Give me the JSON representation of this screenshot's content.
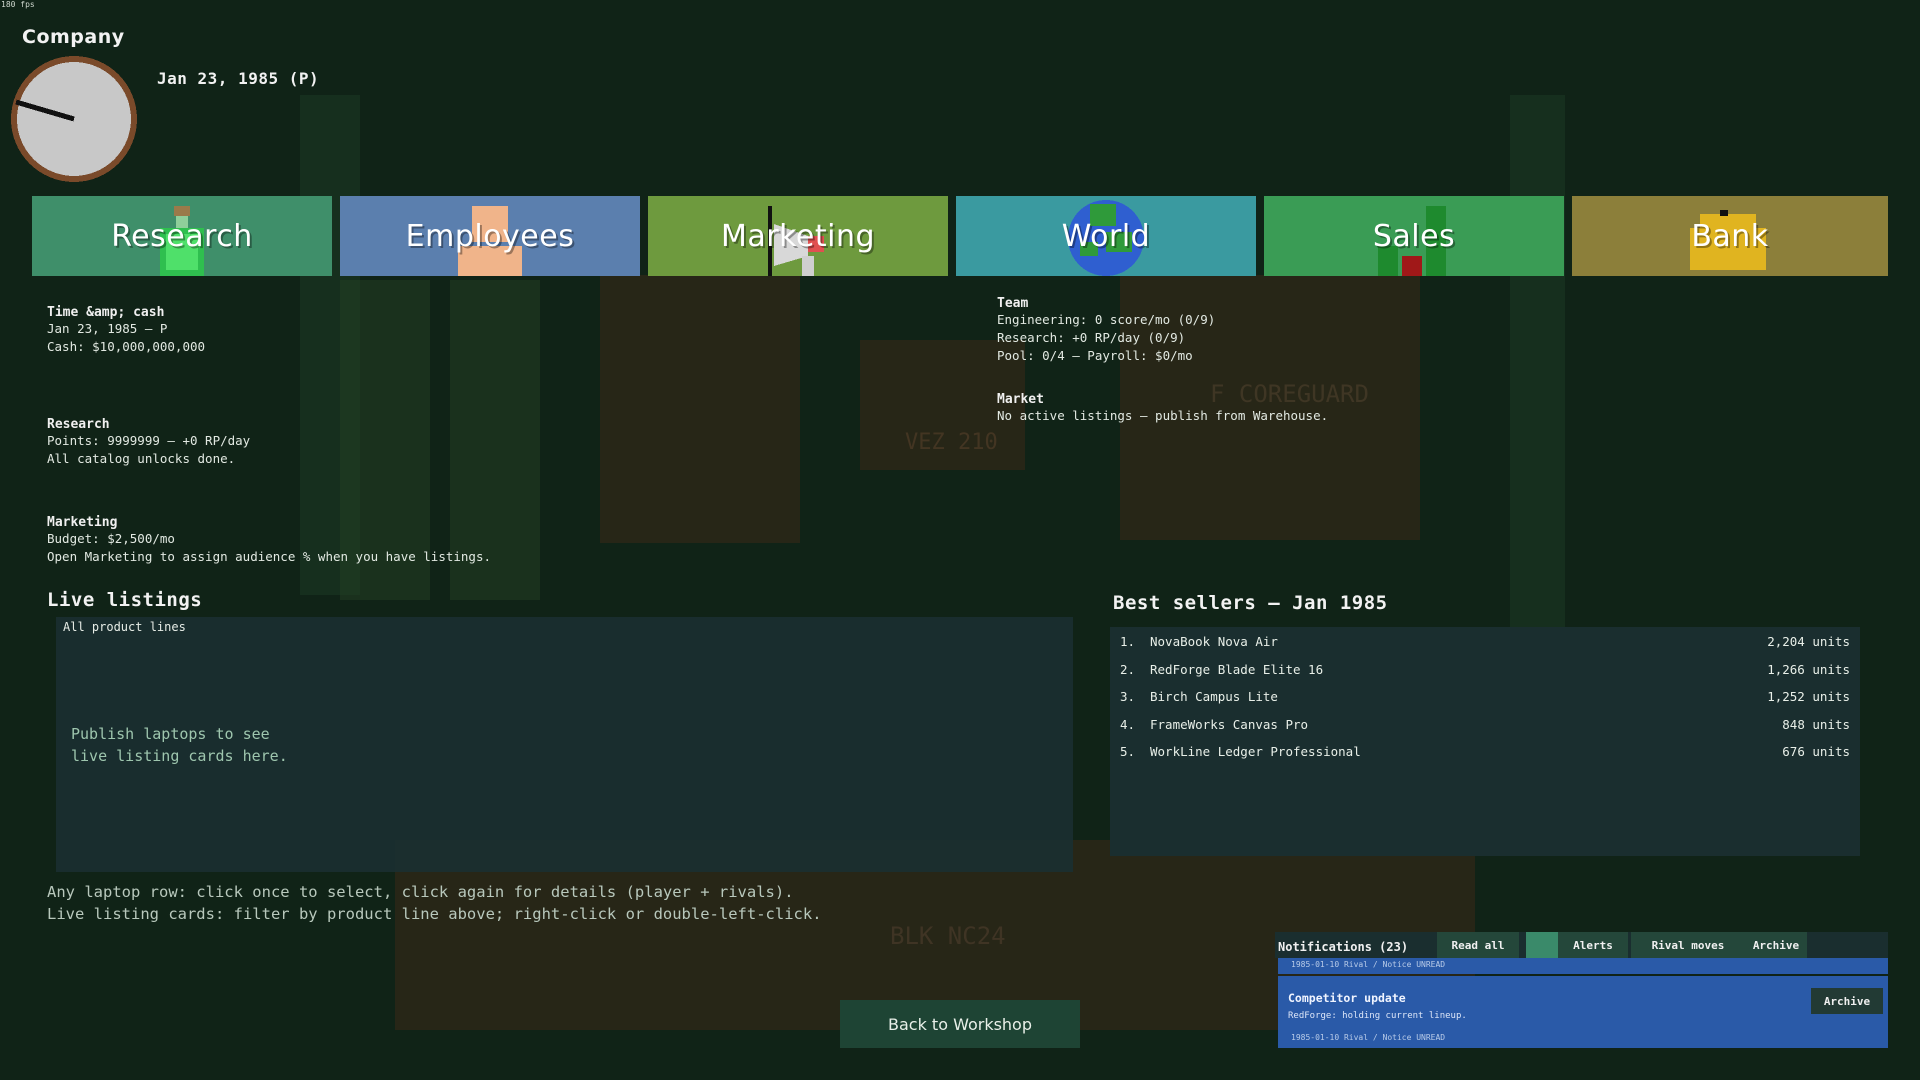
{
  "fps": "180 fps",
  "header": {
    "title": "Company",
    "date": "Jan 23, 1985 (P)"
  },
  "tabs": [
    {
      "label": "Research",
      "color": "#3f8f6a"
    },
    {
      "label": "Employees",
      "color": "#5b7fae"
    },
    {
      "label": "Marketing",
      "color": "#6e9a3e"
    },
    {
      "label": "World",
      "color": "#3a9aa0"
    },
    {
      "label": "Sales",
      "color": "#3a9c55"
    },
    {
      "label": "Bank",
      "color": "#8c7f3a"
    }
  ],
  "overview": {
    "time_cash": {
      "heading": "Time &amp; cash",
      "lines": [
        "Jan 23, 1985  –  P",
        "Cash: $10,000,000,000"
      ]
    },
    "research": {
      "heading": "Research",
      "lines": [
        "Points: 9999999  –  +0 RP/day",
        "All catalog unlocks done."
      ]
    },
    "marketing": {
      "heading": "Marketing",
      "lines": [
        "Budget: $2,500/mo",
        "Open Marketing to assign audience % when you have listings."
      ]
    },
    "team": {
      "heading": "Team",
      "lines": [
        "Engineering: 0 score/mo (0/9)",
        "Research: +0 RP/day (0/9)",
        "Pool: 0/4  –  Payroll: $0/mo"
      ]
    },
    "market": {
      "heading": "Market",
      "lines": [
        "No active listings – publish from Warehouse."
      ]
    }
  },
  "live_listings": {
    "title": "Live listings",
    "filter": "All product lines",
    "empty_message": "Publish laptops to see live listing cards here.",
    "hints": [
      "Any laptop row: click once to select, click again for details (player + rivals).",
      "Live listing cards: filter by product line above; right-click or double-left-click."
    ]
  },
  "best_sellers": {
    "title": "Best sellers – Jan 1985",
    "rows": [
      {
        "rank": "1.",
        "name": "NovaBook Nova Air",
        "units": "2,204 units"
      },
      {
        "rank": "2.",
        "name": "RedForge Blade Elite 16",
        "units": "1,266 units"
      },
      {
        "rank": "3.",
        "name": "Birch Campus Lite",
        "units": "1,252 units"
      },
      {
        "rank": "4.",
        "name": "FrameWorks Canvas Pro",
        "units": "848 units"
      },
      {
        "rank": "5.",
        "name": "WorkLine Ledger Professional",
        "units": "676 units"
      }
    ]
  },
  "back_button": "Back to Workshop",
  "notifications": {
    "title": "Notifications (23)",
    "buttons": [
      "Read all",
      "Alerts",
      "Rival moves",
      "Archive"
    ],
    "card_top_meta": "1985-01-10   Rival / Notice   UNREAD",
    "card": {
      "title": "Competitor update",
      "body": "RedForge: holding current lineup.",
      "meta": "1985-01-10   Rival / Notice   UNREAD",
      "archive": "Archive"
    }
  },
  "background_text": [
    "F COREGUARD",
    "VEZ 210",
    "BLK NC24"
  ]
}
